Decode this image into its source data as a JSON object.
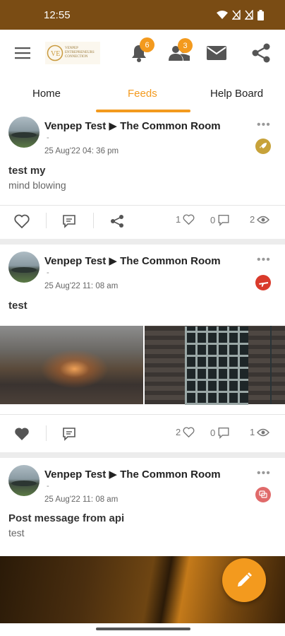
{
  "status_bar": {
    "time": "12:55"
  },
  "header": {
    "logo_text": "VENPEP ENTREPRENEURS CONNECTION",
    "notifications_count": "6",
    "connections_count": "3"
  },
  "tabs": [
    {
      "label": "Home"
    },
    {
      "label": "Feeds"
    },
    {
      "label": "Help Board"
    }
  ],
  "posts": [
    {
      "author": "Venpep Test ▶ The Common Room",
      "dash": "-",
      "time": "25 Aug'22 04: 36 pm",
      "title": "test my",
      "body": "mind blowing",
      "likes": "1",
      "comments": "0",
      "views": "2"
    },
    {
      "author": "Venpep Test ▶ The Common Room",
      "dash": "-",
      "time": "25 Aug'22 11: 08 am",
      "title": "test",
      "likes": "2",
      "comments": "0",
      "views": "1"
    },
    {
      "author": "Venpep Test ▶ The Common Room",
      "dash": "-",
      "time": "25 Aug'22 11: 08 am",
      "title": "Post message from api",
      "body": "test"
    }
  ],
  "colors": {
    "accent": "#f39a1e",
    "status_bar": "#7a4c14",
    "badge_gold": "#c7a23a",
    "badge_red": "#d93a2b",
    "badge_pink": "#e06a6a"
  },
  "icons": [
    "menu-icon",
    "bell-icon",
    "people-icon",
    "mail-icon",
    "share-icon",
    "heart-icon",
    "comment-icon",
    "eye-icon",
    "edit-icon",
    "wifi-icon",
    "battery-icon"
  ]
}
